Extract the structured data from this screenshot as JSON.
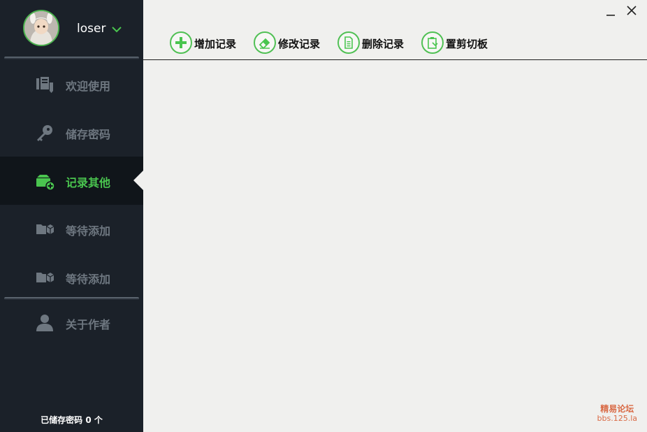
{
  "user": {
    "name": "loser"
  },
  "sidebar": {
    "items": [
      {
        "label": "欢迎使用",
        "icon": "welcome-icon",
        "active": false
      },
      {
        "label": "储存密码",
        "icon": "key-icon",
        "active": false
      },
      {
        "label": "记录其他",
        "icon": "record-add-icon",
        "active": true
      },
      {
        "label": "等待添加",
        "icon": "folder-box-icon",
        "active": false
      },
      {
        "label": "等待添加",
        "icon": "folder-box-icon",
        "active": false
      },
      {
        "label": "关于作者",
        "icon": "person-icon",
        "active": false
      }
    ],
    "status": "已储存密码 0 个"
  },
  "toolbar": {
    "add_label": "增加记录",
    "edit_label": "修改记录",
    "delete_label": "删除记录",
    "clipboard_label": "置剪切板"
  },
  "watermark": {
    "line1": "精易论坛",
    "line2": "bbs.125.la"
  },
  "colors": {
    "accent": "#4ac54f",
    "sidebar_bg": "#1b2129",
    "active_bg": "#10151a",
    "content_bg": "#f0f0ee",
    "inactive_text": "#6e7780",
    "watermark": "#d96a45"
  }
}
